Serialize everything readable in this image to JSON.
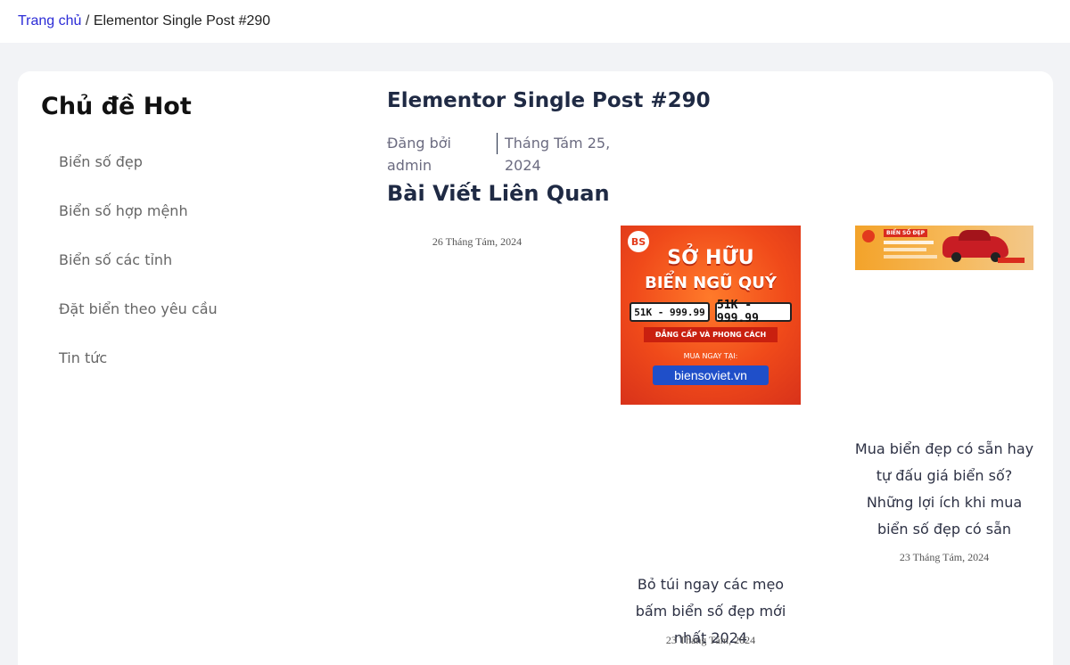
{
  "breadcrumb": {
    "home": "Trang chủ",
    "separator": "/",
    "current": "Elementor Single Post #290"
  },
  "sidebar": {
    "title": "Chủ đề Hot",
    "items": [
      {
        "label": "Biển số đẹp"
      },
      {
        "label": "Biển số hợp mệnh"
      },
      {
        "label": "Biển số các tỉnh"
      },
      {
        "label": "Đặt biển theo yêu cầu"
      },
      {
        "label": "Tin tức"
      }
    ]
  },
  "post": {
    "title": "Elementor Single Post #290",
    "author": "Đăng bởi admin",
    "date": "Tháng Tám 25, 2024"
  },
  "related": {
    "title": "Bài Viết Liên Quan",
    "items": [
      {
        "date": "26 Tháng Tám, 2024"
      },
      {
        "headline": "Bỏ túi ngay các mẹo bấm biển số đẹp mới nhất 2024",
        "date": "23 Tháng Tám, 2024",
        "thumb": {
          "logo": "BS",
          "line1": "SỞ HỮU",
          "line2": "BIỂN NGŨ QUÝ",
          "plate_a": "51K - 999.99",
          "plate_b": "51K - 999.99",
          "banner": "ĐẲNG CẤP VÀ PHONG CÁCH",
          "buy_now": "MUA NGAY TẠI:",
          "site": "biensoviet.vn"
        }
      },
      {
        "headline": "Mua biển đẹp có sẵn hay tự đấu giá biển số? Những lợi ích khi mua biển số đẹp có sẵn",
        "date": "23 Tháng Tám, 2024",
        "thumb": {
          "tag": "BIỂN SỐ ĐẸP"
        }
      }
    ]
  },
  "colors": {
    "link": "#2b2bd6",
    "heading": "#1f2a44",
    "page_bg": "#f2f3f6",
    "promo_orange": "#f04a1a",
    "site_blue": "#1f4fc9"
  }
}
